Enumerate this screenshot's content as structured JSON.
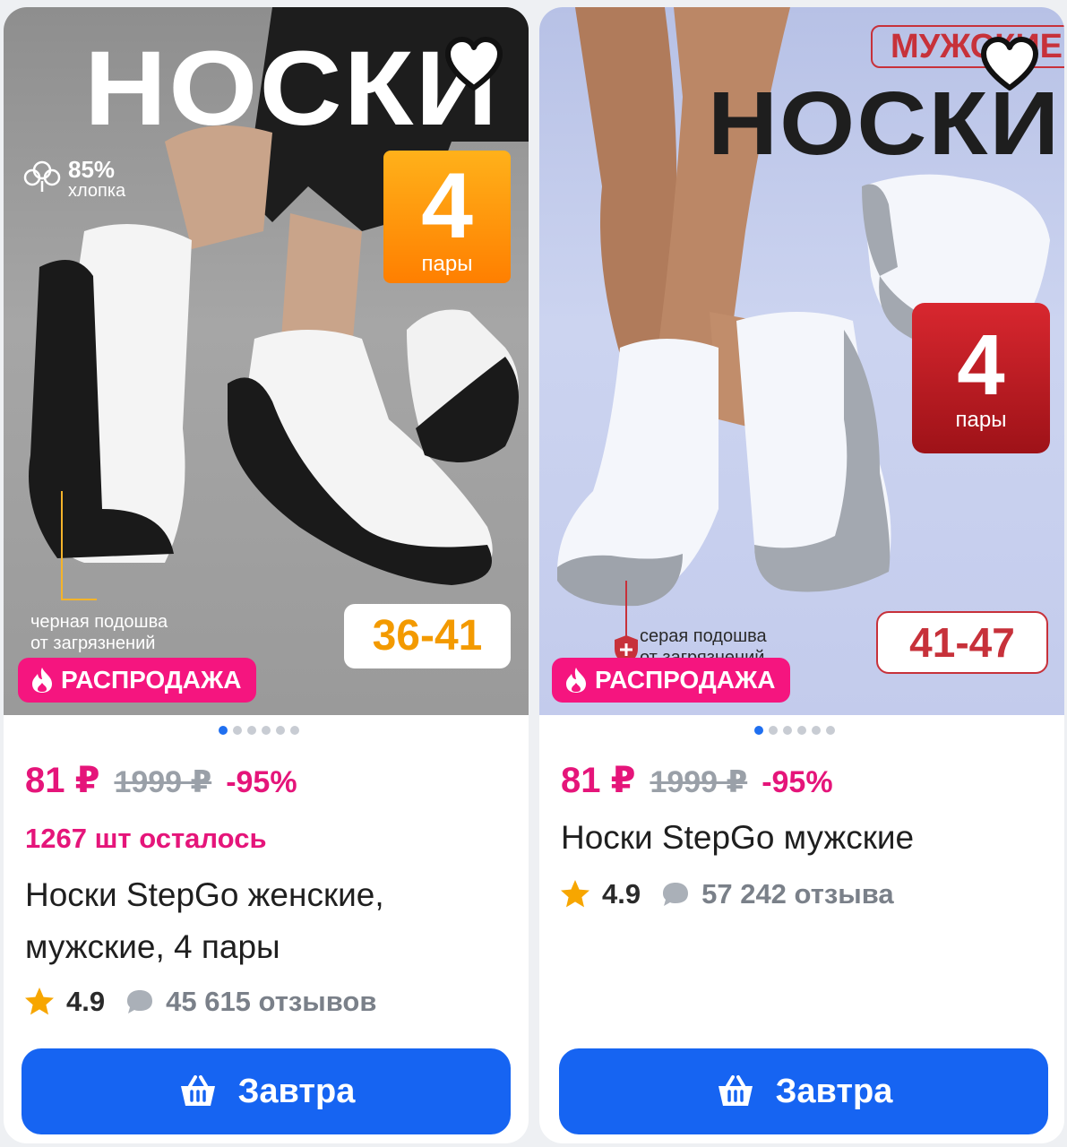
{
  "products": [
    {
      "image": {
        "title": "НОСКИ",
        "cotton_pct": "85%",
        "cotton_label": "хлопка",
        "pairs_number": "4",
        "pairs_unit": "пары",
        "size": "36-41",
        "note_line1": "черная подошва",
        "note_line2": "от загрязнений",
        "sale_label": "РАСПРОДАЖА",
        "slide_count": 6,
        "active_slide": 0
      },
      "price": "81 ₽",
      "old_price": "1999 ₽",
      "discount": "-95%",
      "stock": "1267 шт осталось",
      "title": "Носки StepGo женские, мужские, 4 пары",
      "rating": "4.9",
      "reviews": "45 615 отзывов",
      "button_label": "Завтра"
    },
    {
      "image": {
        "badge": "МУЖСКИЕ",
        "title": "НОСКИ",
        "pairs_number": "4",
        "pairs_unit": "пары",
        "size": "41-47",
        "note_line1": "серая подошва",
        "note_line2": "от загрязнений",
        "sale_label": "РАСПРОДАЖА",
        "slide_count": 6,
        "active_slide": 0
      },
      "price": "81 ₽",
      "old_price": "1999 ₽",
      "discount": "-95%",
      "title": "Носки StepGo мужские",
      "rating": "4.9",
      "reviews": "57 242 отзыва",
      "button_label": "Завтра"
    }
  ],
  "colors": {
    "accent_pink": "#e5157a",
    "sale_badge": "#f5157f",
    "button_blue": "#1664f2",
    "star": "#f7a600"
  },
  "icons": {
    "favorite": "heart-outline-icon",
    "sale": "fire-icon",
    "reviews": "chat-bubble-icon",
    "rating": "star-icon",
    "cart": "basket-icon"
  }
}
